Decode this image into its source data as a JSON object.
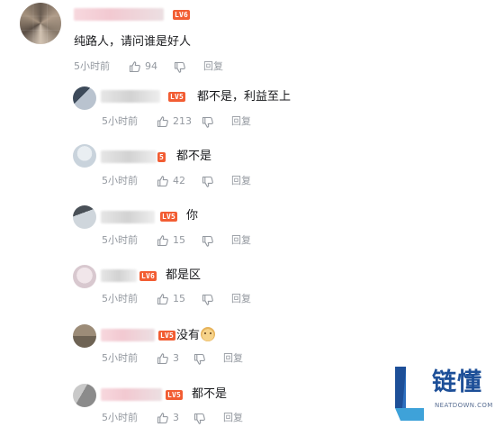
{
  "top_comment": {
    "text": "纯路人，请问谁是好人",
    "time": "5小时前",
    "likes": "94",
    "reply_label": "回复",
    "level": "LV6"
  },
  "replies": [
    {
      "text": "都不是，利益至上",
      "time": "5小时前",
      "likes": "213",
      "reply_label": "回复",
      "level": "LV5"
    },
    {
      "text": "都不是",
      "time": "5小时前",
      "likes": "42",
      "reply_label": "回复",
      "level": "5"
    },
    {
      "text": "你",
      "time": "5小时前",
      "likes": "15",
      "reply_label": "回复",
      "level": "LV5"
    },
    {
      "text": "都是区",
      "time": "5小时前",
      "likes": "15",
      "reply_label": "回复",
      "level": "LV6"
    },
    {
      "text": "没有",
      "time": "5小时前",
      "likes": "3",
      "reply_label": "回复",
      "level": "LV5"
    },
    {
      "text": "都不是",
      "time": "5小时前",
      "likes": "3",
      "reply_label": "回复",
      "level": "LV5"
    }
  ],
  "watermark": {
    "brand": "链懂",
    "domain": "NEATDOWN.COM"
  },
  "icons": {
    "like": "thumbs-up-icon",
    "dislike": "thumbs-down-icon"
  },
  "colors": {
    "text": "#18191c",
    "meta": "#9499a0",
    "level_badge": "#f25d33",
    "brand_blue": "#1d4f98"
  }
}
